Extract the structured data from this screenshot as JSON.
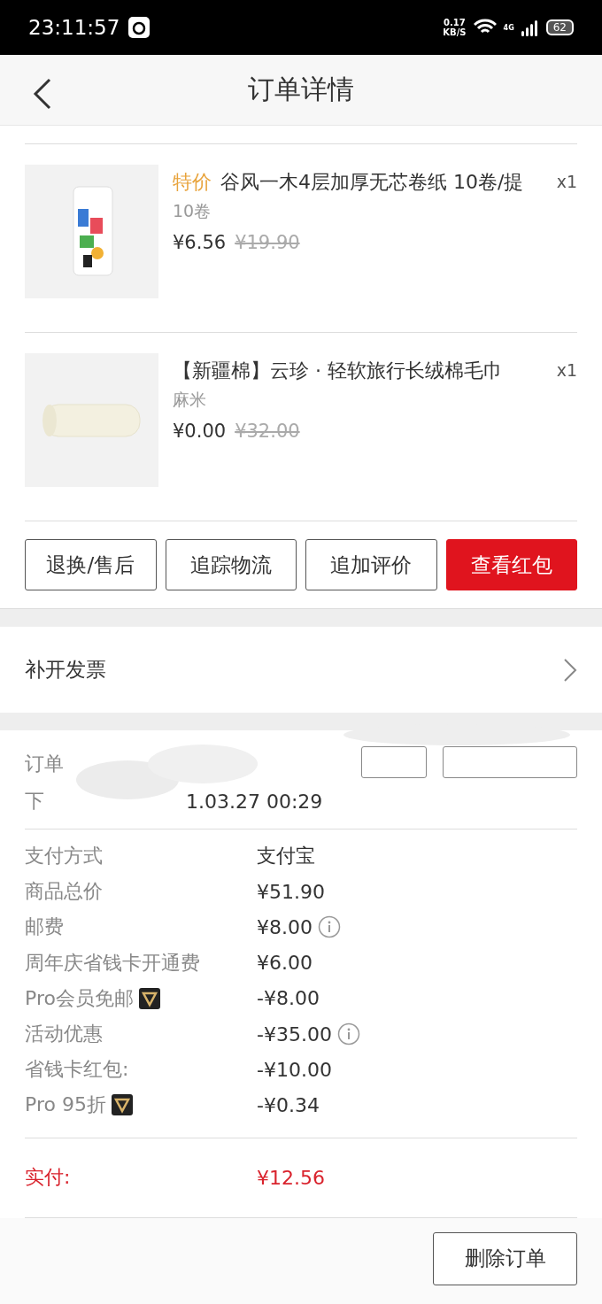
{
  "status_bar": {
    "time": "23:11:57",
    "speed": "0.17",
    "speed_unit": "KB/S",
    "network": "4G",
    "battery": "62"
  },
  "header": {
    "title": "订单详情"
  },
  "products": [
    {
      "tag": "特价",
      "name": "谷风一木4层加厚无芯卷纸 10卷/提",
      "spec": "10卷",
      "price": "¥6.56",
      "original_price": "¥19.90",
      "qty": "x1",
      "kind": "tissue"
    },
    {
      "name": "【新疆棉】云珍 · 轻软旅行长绒棉毛巾",
      "spec": "麻米",
      "price": "¥0.00",
      "original_price": "¥32.00",
      "qty": "x1",
      "kind": "towel"
    }
  ],
  "actions": [
    {
      "label": "退换/售后",
      "primary": false
    },
    {
      "label": "追踪物流",
      "primary": false
    },
    {
      "label": "追加评价",
      "primary": false
    },
    {
      "label": "查看红包",
      "primary": true
    }
  ],
  "invoice": {
    "label": "补开发票"
  },
  "order_info": {
    "number_label": "订单",
    "time_label": "下",
    "time_value": "1.03.27 00:29"
  },
  "payment": [
    {
      "label": "支付方式",
      "value": "支付宝"
    },
    {
      "label": "商品总价",
      "value": "¥51.90"
    },
    {
      "label": "邮费",
      "value": "¥8.00",
      "info": true
    },
    {
      "label": "周年庆省钱卡开通费",
      "value": "¥6.00"
    },
    {
      "label": "Pro会员免邮",
      "value": "-¥8.00",
      "badge": true
    },
    {
      "label": "活动优惠",
      "value": "-¥35.00",
      "info": true
    },
    {
      "label": "省钱卡红包:",
      "value": "-¥10.00"
    },
    {
      "label": "Pro 95折",
      "value": "-¥0.34",
      "badge": true
    }
  ],
  "total": {
    "label": "实付:",
    "value": "¥12.56"
  },
  "footer": {
    "button": "删除订单"
  }
}
